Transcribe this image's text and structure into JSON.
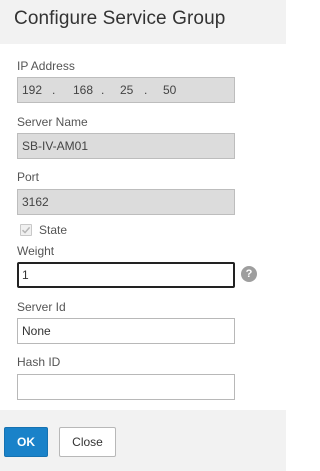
{
  "dialog": {
    "title": "Configure Service Group"
  },
  "fields": {
    "ip_address": {
      "label": "IP Address",
      "octets": [
        "192",
        "168",
        "25",
        "50"
      ],
      "dot": "."
    },
    "server_name": {
      "label": "Server Name",
      "value": "SB-IV-AM01"
    },
    "port": {
      "label": "Port",
      "value": "3162"
    },
    "state": {
      "label": "State",
      "checked": true
    },
    "weight": {
      "label": "Weight",
      "value": "1",
      "help": "?"
    },
    "server_id": {
      "label": "Server Id",
      "value": "None"
    },
    "hash_id": {
      "label": "Hash ID",
      "value": ""
    }
  },
  "footer": {
    "ok_label": "OK",
    "close_label": "Close"
  },
  "colors": {
    "primary_button": "#1a82c9",
    "header_bg": "#f2f2f2",
    "disabled_field": "#dcdcdc"
  }
}
